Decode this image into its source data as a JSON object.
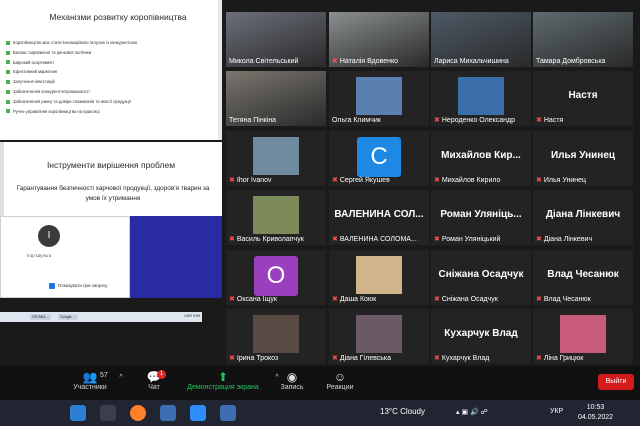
{
  "slide1": {
    "title": "Механізми розвитку коропівництва",
    "bullets": [
      "Коропівництво має стати інноваційною галуззю із конкурентною",
      "Баланс сировинної та ринкової політики",
      "Широкий асортимент",
      "Ефективний маркетинг",
      "Залучення інвестицій",
      "Забезпечення конкурентоспроможності",
      "Забезпечення ринку та довіри споживачів та якості продукції",
      "Ручне управління коропівництва на практиці"
    ]
  },
  "slide2": {
    "title": "Інструменти вирішення проблем",
    "subtitle": "Гарантування безпечності харчової продукції, здоров'я тварин за умов їх утримання"
  },
  "dialog": {
    "avatar_letter": "I",
    "name": "Ігор Шульга",
    "checkbox_label": "Показувати при запуску"
  },
  "mini_taskbar": {
    "chips": [
      "ОП ВЕА...",
      "Google ..."
    ],
    "tray": "UKR  9:59"
  },
  "tiles": [
    {
      "name": "Микола Світельський",
      "muted": false,
      "type": "video",
      "color": "#6b6f7a"
    },
    {
      "name": "Наталія Вдовенко",
      "muted": true,
      "type": "video",
      "color": "#8a8f90"
    },
    {
      "name": "Лариса Михальчишина",
      "muted": false,
      "type": "video",
      "color": "#4d5a66"
    },
    {
      "name": "Тамара Домбровська",
      "muted": false,
      "type": "video",
      "color": "#5e6a6e"
    },
    {
      "name": "Тетяна Пінкіна",
      "muted": false,
      "type": "video",
      "color": "#7a766f",
      "active": true
    },
    {
      "name": "Ольга Климчик",
      "muted": false,
      "type": "pic",
      "color": "#5b7fb0"
    },
    {
      "name": "Нероденко Олександр",
      "muted": true,
      "type": "pic",
      "color": "#3a6ea8"
    },
    {
      "name": "Настя",
      "muted": true,
      "type": "text",
      "big": "Настя"
    },
    {
      "name": "Ihor Ivanov",
      "muted": true,
      "type": "pic",
      "color": "#6e8a9c"
    },
    {
      "name": "Сергей Якушев",
      "muted": true,
      "type": "letter",
      "letter": "C",
      "color": "#1e88e5"
    },
    {
      "name": "Михайлов Кирило",
      "muted": true,
      "type": "text",
      "big": "Михайлов Кир..."
    },
    {
      "name": "Илья Унинец",
      "muted": true,
      "type": "text",
      "big": "Илья Унинец"
    },
    {
      "name": "Василь Криволапчук",
      "muted": true,
      "type": "pic",
      "color": "#7d8a5a"
    },
    {
      "name": "ВАЛЕНИНА СОЛОМА...",
      "muted": true,
      "type": "text",
      "big": "ВАЛЕНИНА СОЛ..."
    },
    {
      "name": "Роман Уляніцький",
      "muted": true,
      "type": "text",
      "big": "Роман Уляніць..."
    },
    {
      "name": "Діана Лінкевич",
      "muted": true,
      "type": "text",
      "big": "Діана Лінкевич"
    },
    {
      "name": "Оксана Іщук",
      "muted": true,
      "type": "letter",
      "letter": "O",
      "color": "#9c3fbf"
    },
    {
      "name": "Даша Коюк",
      "muted": true,
      "type": "pic",
      "color": "#d2b48c"
    },
    {
      "name": "Сніжана Осадчук",
      "muted": true,
      "type": "text",
      "big": "Сніжана Осадчук"
    },
    {
      "name": "Влад Чесанюк",
      "muted": true,
      "type": "text",
      "big": "Влад Чесанюк"
    },
    {
      "name": "Ірина Трокоз",
      "muted": true,
      "type": "pic",
      "color": "#5a4a44"
    },
    {
      "name": "Діана Гілевська",
      "muted": true,
      "type": "pic",
      "color": "#6b5a66"
    },
    {
      "name": "Кухарчук Влад",
      "muted": true,
      "type": "text",
      "big": "Кухарчук Влад"
    },
    {
      "name": "Ліна Грицюк",
      "muted": true,
      "type": "pic",
      "color": "#c85a7a"
    }
  ],
  "controls": {
    "participants_label": "Участники",
    "participants_count": "57",
    "chat_label": "Чат",
    "chat_badge": "1",
    "share_label": "Демонстрация экрана",
    "record_label": "Запись",
    "reactions_label": "Реакции",
    "exit_label": "Выйти"
  },
  "taskbar": {
    "weather": "13°C  Cloudy",
    "lang": "УКР",
    "time": "10:53",
    "date": "04.05.2022"
  }
}
